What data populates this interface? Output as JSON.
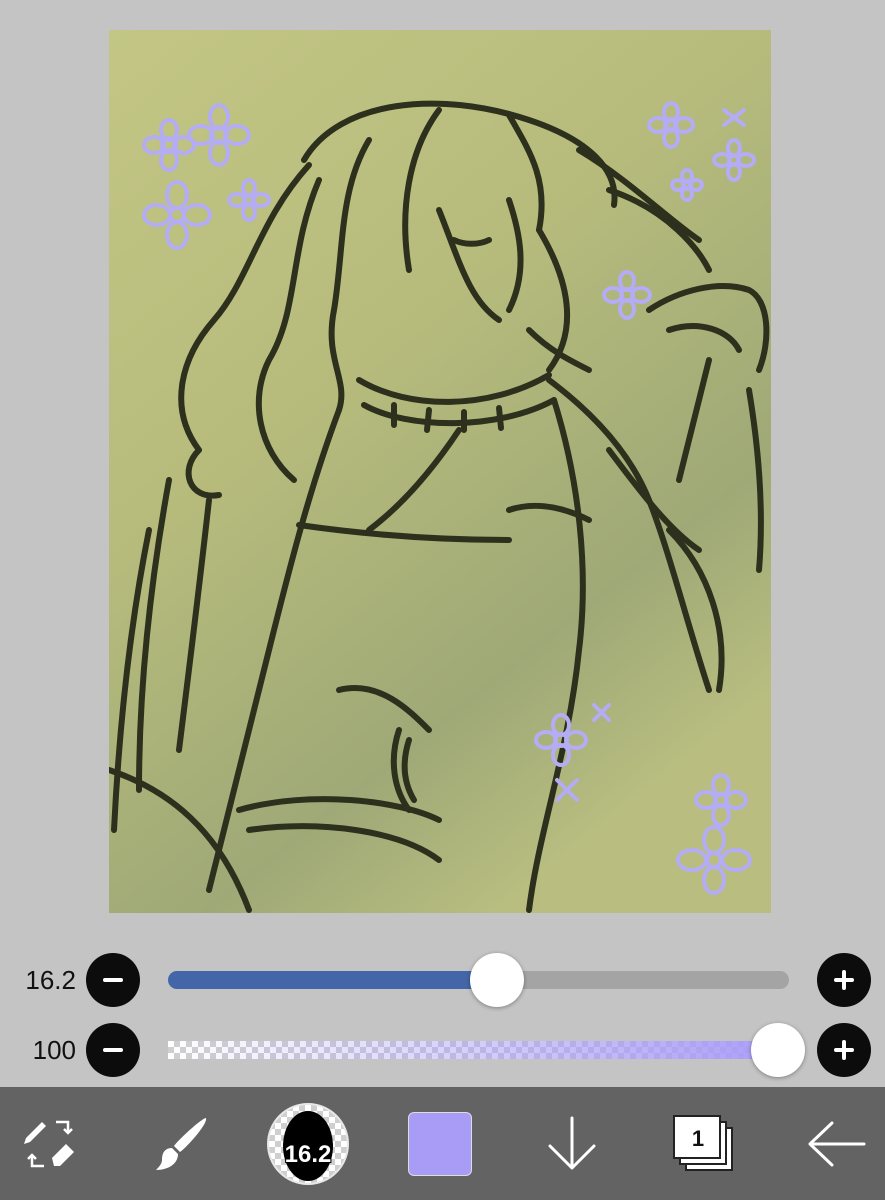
{
  "sliders": {
    "brush_size": {
      "value_label": "16.2",
      "fraction": 0.53,
      "fill_color": "#4466a8",
      "track_color": "#a4a4a4"
    },
    "opacity": {
      "value_label": "100",
      "fraction": 1.0,
      "fill_color": "#a89cf7"
    }
  },
  "toolbar": {
    "brush_preview_label": "16.2",
    "current_color": "#a89cf7",
    "layer_count": "1"
  },
  "icons": {
    "swap": "pen-eraser-swap-icon",
    "brush": "brush-icon",
    "down": "arrow-down-icon",
    "layers": "layers-icon",
    "back": "arrow-left-icon"
  },
  "colors": {
    "canvas_bg": "#c4c4c4",
    "toolbar_bg": "#636363",
    "artwork_bg": "#b8bd7e",
    "line": "#2d301c",
    "flower": "#b4acf4"
  }
}
